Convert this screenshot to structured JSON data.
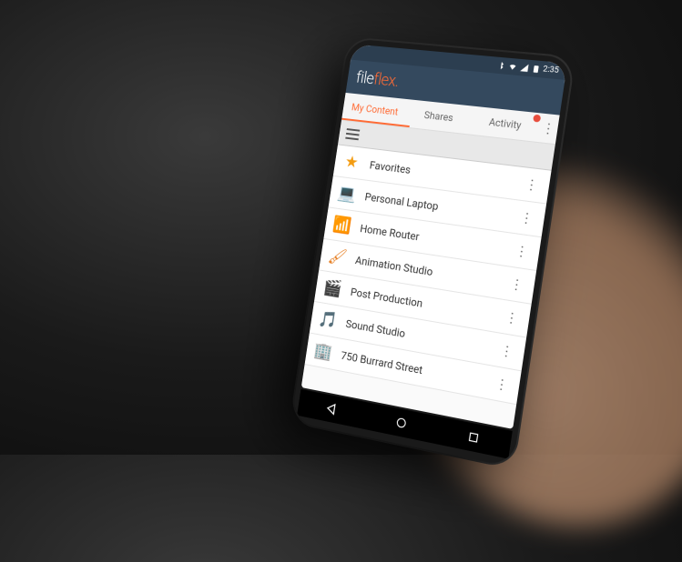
{
  "status": {
    "time": "2:35"
  },
  "app": {
    "logo_prefix": "file",
    "logo_suffix": "flex",
    "logo_dot": "."
  },
  "tabs": [
    {
      "label": "My Content",
      "active": true
    },
    {
      "label": "Shares",
      "active": false
    },
    {
      "label": "Activity",
      "active": false
    }
  ],
  "items": [
    {
      "icon": "star",
      "label": "Favorites"
    },
    {
      "icon": "laptop",
      "label": "Personal Laptop"
    },
    {
      "icon": "router",
      "label": "Home Router"
    },
    {
      "icon": "animation",
      "label": "Animation Studio"
    },
    {
      "icon": "production",
      "label": "Post Production"
    },
    {
      "icon": "sound",
      "label": "Sound Studio"
    },
    {
      "icon": "building",
      "label": "750 Burrard Street"
    }
  ]
}
